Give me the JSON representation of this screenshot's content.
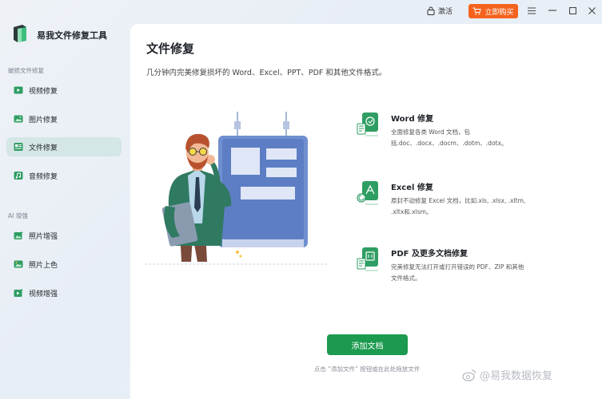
{
  "titlebar": {
    "activate_label": "激活",
    "buy_label": "立即购买"
  },
  "sidebar": {
    "app_title": "易我文件修复工具",
    "section_repair": "破损文件修复",
    "repair_items": [
      {
        "label": "视频修复",
        "icon": "video-icon"
      },
      {
        "label": "图片修复",
        "icon": "image-icon"
      },
      {
        "label": "文件修复",
        "icon": "document-icon",
        "active": true
      },
      {
        "label": "音频修复",
        "icon": "audio-icon"
      }
    ],
    "section_ai": "AI 增强",
    "ai_items": [
      {
        "label": "照片增强",
        "icon": "photo-enhance-icon"
      },
      {
        "label": "照片上色",
        "icon": "photo-colorize-icon"
      },
      {
        "label": "视频增强",
        "icon": "video-enhance-icon"
      }
    ]
  },
  "main": {
    "title": "文件修复",
    "subtitle": "几分钟内完美修复损坏的 Word、Excel、PPT、PDF 和其他文件格式。",
    "features": [
      {
        "name": "Word 修复",
        "desc": "全面修复各类 Word 文档，包括.doc、.docx、.docm、.dotm、.dotx。",
        "icon": "word-doc-icon"
      },
      {
        "name": "Excel 修复",
        "desc": "原封不动修复 Excel 文档，比如.xls, .xlsx, .xltm, .xltx和.xlsm。",
        "icon": "excel-doc-icon"
      },
      {
        "name": "PDF 及更多文档修复",
        "desc": "完美修复无法打开或打开错误的 PDF、ZIP 和其他文件格式。",
        "icon": "pdf-doc-icon"
      }
    ],
    "add_button": "添加文档",
    "hint": "点击 “添加文件” 按钮或在此处拖放文件"
  },
  "watermark": "@易我数据恢复",
  "colors": {
    "accent": "#1c9a4f",
    "buy": "#f5631e",
    "active_nav": "#d4e6e6"
  }
}
